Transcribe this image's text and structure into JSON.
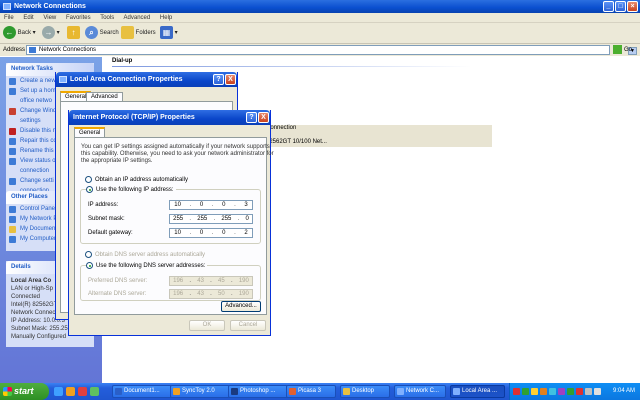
{
  "window": {
    "title": "Network Connections"
  },
  "menu": [
    "File",
    "Edit",
    "View",
    "Favorites",
    "Tools",
    "Advanced",
    "Help"
  ],
  "toolbar": {
    "back": "Back",
    "search": "Search",
    "folders": "Folders"
  },
  "address": {
    "label": "Address",
    "value": "Network Connections",
    "go": "Go"
  },
  "network_tasks": {
    "title": "Network Tasks",
    "items": [
      "Create a new",
      "Set up a home",
      "office netwo",
      "Change Wind",
      "settings",
      "Disable this n",
      "Repair this co",
      "Rename this",
      "View status o",
      "connection",
      "Change setti",
      "connection"
    ]
  },
  "other_places": {
    "title": "Other Places",
    "items": [
      "Control Panel",
      "My Network P",
      "My Documen",
      "My Computer"
    ]
  },
  "details": {
    "title": "Details",
    "lines": [
      "Local Area Co",
      "LAN or High-Sp",
      "Connected",
      "Intel(R) 82562GT 10/100",
      "Network Connection",
      "IP Address: 10.0.0.3",
      "Subnet Mask: 255.255.255.0",
      "Manually Configured"
    ]
  },
  "content": {
    "group_dialup": "Dial-up",
    "connection_lines": [
      "Connection",
      "d",
      "82562GT 10/100 Net..."
    ]
  },
  "lac_dialog": {
    "title": "Local Area Connection Properties",
    "tabs": [
      "General",
      "Advanced"
    ],
    "help": "?",
    "close": "X"
  },
  "tcpip_dialog": {
    "title": "Internet Protocol (TCP/IP) Properties",
    "tab": "General",
    "help": "?",
    "close": "X",
    "description": [
      "You can get IP settings assigned automatically if your network supports",
      "this capability. Otherwise, you need to ask your network administrator for",
      "the appropriate IP settings."
    ],
    "radio_auto_ip": "Obtain an IP address automatically",
    "radio_manual_ip": "Use the following IP address:",
    "ip_label": "IP address:",
    "ip": [
      "10",
      "0",
      "0",
      "3"
    ],
    "mask_label": "Subnet mask:",
    "mask": [
      "255",
      "255",
      "255",
      "0"
    ],
    "gateway_label": "Default gateway:",
    "gateway": [
      "10",
      "0",
      "0",
      "2"
    ],
    "radio_auto_dns": "Obtain DNS server address automatically",
    "radio_manual_dns": "Use the following DNS server addresses:",
    "pref_dns_label": "Preferred DNS server:",
    "pref_dns": [
      "196",
      "43",
      "45",
      "190"
    ],
    "alt_dns_label": "Alternate DNS server:",
    "alt_dns": [
      "196",
      "43",
      "50",
      "190"
    ],
    "advanced": "Advanced...",
    "ok": "OK",
    "cancel": "Cancel"
  },
  "taskbar": {
    "start": "start",
    "tasks": [
      "Document1...",
      "SyncToy 2.0",
      "Photoshop ...",
      "Picasa 3",
      "Desktop",
      "Network C...",
      "Local Area ..."
    ],
    "clock": "9:04 AM"
  }
}
